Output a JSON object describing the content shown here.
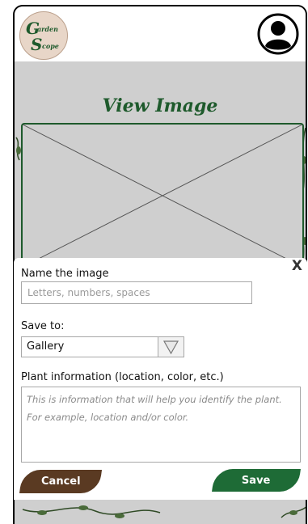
{
  "app": {
    "logo_letter_1": "G",
    "logo_small_1": "arden",
    "logo_letter_2": "S",
    "logo_small_2": "cope",
    "profile_icon": "user-avatar-icon"
  },
  "page": {
    "title": "View Image"
  },
  "dialog": {
    "close_label": "X",
    "name_label": "Name the image",
    "name_placeholder": "Letters, numbers, spaces",
    "name_value": "",
    "save_to_label": "Save to:",
    "save_to_value": "Gallery",
    "plant_info_label": "Plant information (location, color, etc.)",
    "plant_info_placeholder": "This is information that will help you identify the plant. For example, location and/or color.",
    "cancel_label": "Cancel",
    "save_label": "Save"
  },
  "colors": {
    "brand_green": "#1e5a2c",
    "save_green": "#1e6b36",
    "cancel_brown": "#5a3a22",
    "backdrop_gray": "#cfcfcf",
    "logo_bg": "#e8d6c8"
  }
}
